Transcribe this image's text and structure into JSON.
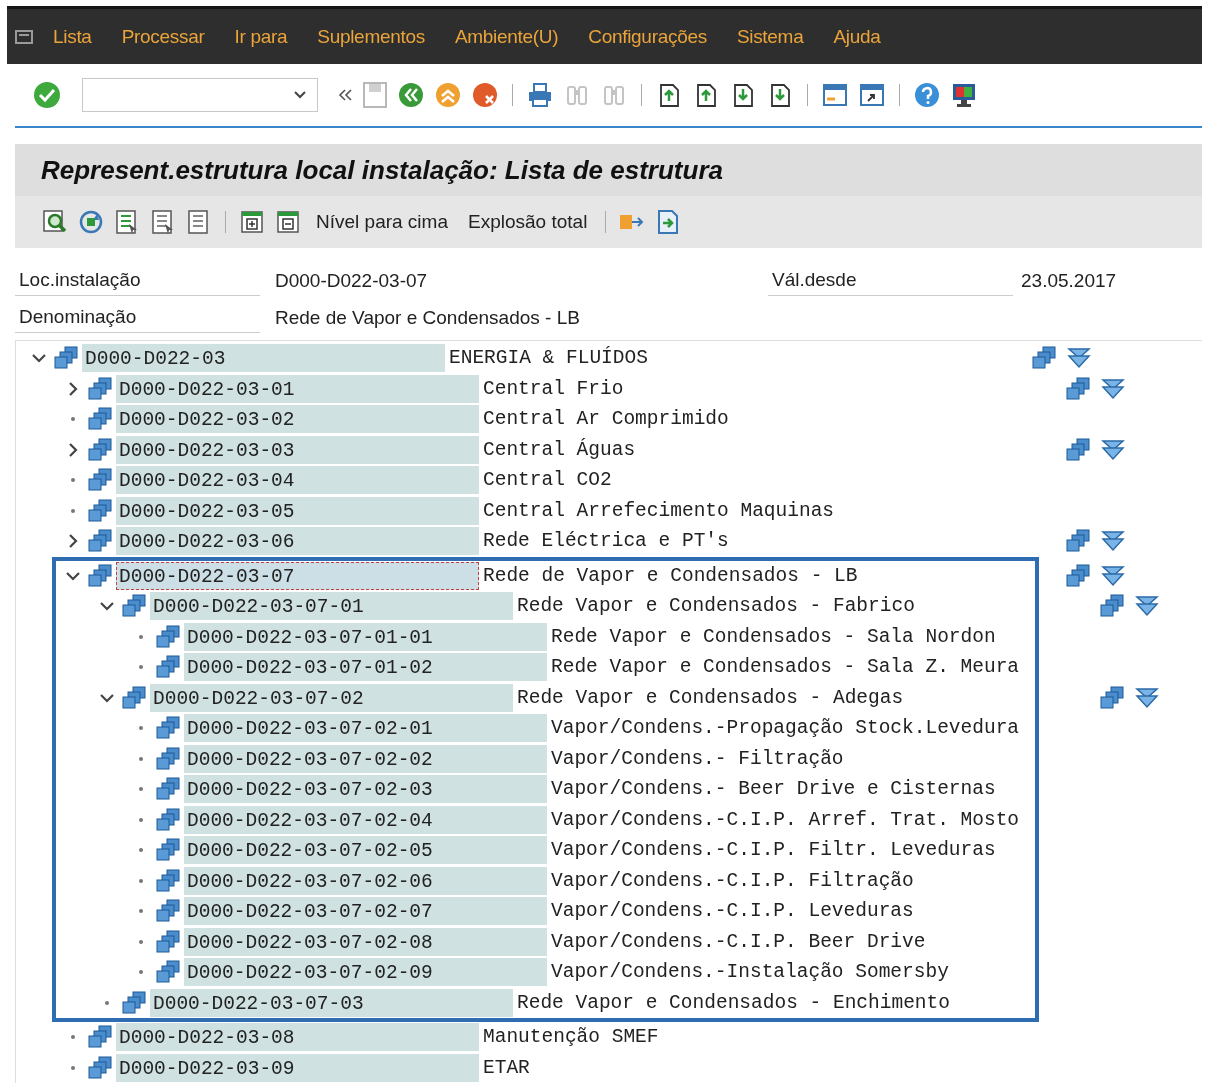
{
  "menu": [
    {
      "label": "Lista"
    },
    {
      "label": "Processar"
    },
    {
      "label": "Ir para"
    },
    {
      "label": "Suplementos"
    },
    {
      "label": "Ambiente(U)"
    },
    {
      "label": "Configurações"
    },
    {
      "label": "Sistema"
    },
    {
      "label": "Ajuda"
    }
  ],
  "title": "Represent.estrutura local instalação: Lista de estrutura",
  "app_toolbar": {
    "buttons": [
      {
        "label": "Nível para cima"
      },
      {
        "label": "Explosão total"
      }
    ]
  },
  "header": {
    "rows": [
      [
        {
          "label": "Loc.instalação",
          "value": "D000-D022-03-07"
        },
        {
          "label": "Vál.desde",
          "value": "23.05.2017"
        }
      ],
      [
        {
          "label": "Denominação",
          "value": "Rede de Vapor e Condensados - LB"
        }
      ]
    ]
  },
  "tree": [
    {
      "code": "D000-D022-03",
      "text": "ENERGIA & FLUÍDOS",
      "kind": "branch",
      "expanded": true,
      "selected": false,
      "highlighted": false,
      "actions": true,
      "children": [
        {
          "code": "D000-D022-03-01",
          "text": "Central Frio",
          "kind": "branch",
          "expanded": false,
          "selected": false,
          "highlighted": false,
          "actions": true
        },
        {
          "code": "D000-D022-03-02",
          "text": "Central Ar Comprimido",
          "kind": "leaf",
          "selected": false,
          "highlighted": false,
          "actions": false
        },
        {
          "code": "D000-D022-03-03",
          "text": "Central Águas",
          "kind": "branch",
          "expanded": false,
          "selected": false,
          "highlighted": false,
          "actions": true
        },
        {
          "code": "D000-D022-03-04",
          "text": "Central CO2",
          "kind": "leaf",
          "selected": false,
          "highlighted": false,
          "actions": false
        },
        {
          "code": "D000-D022-03-05",
          "text": "Central Arrefecimento Maquinas",
          "kind": "leaf",
          "selected": false,
          "highlighted": false,
          "actions": false
        },
        {
          "code": "D000-D022-03-06",
          "text": "Rede Eléctrica e PT's",
          "kind": "branch",
          "expanded": false,
          "selected": false,
          "highlighted": false,
          "actions": true
        },
        {
          "code": "D000-D022-03-07",
          "text": "Rede de Vapor e Condensados - LB",
          "kind": "branch",
          "expanded": true,
          "selected": true,
          "highlighted": true,
          "actions": true,
          "children": [
            {
              "code": "D000-D022-03-07-01",
              "text": "Rede Vapor e Condensados - Fabrico",
              "kind": "branch",
              "expanded": true,
              "selected": false,
              "highlighted": false,
              "actions": true,
              "children": [
                {
                  "code": "D000-D022-03-07-01-01",
                  "text": "Rede Vapor e Condensados - Sala Nordon",
                  "kind": "leaf",
                  "selected": false,
                  "highlighted": false,
                  "actions": false
                },
                {
                  "code": "D000-D022-03-07-01-02",
                  "text": "Rede Vapor e Condensados - Sala Z. Meura",
                  "kind": "leaf",
                  "selected": false,
                  "highlighted": false,
                  "actions": false
                }
              ]
            },
            {
              "code": "D000-D022-03-07-02",
              "text": "Rede Vapor e Condensados - Adegas",
              "kind": "branch",
              "expanded": true,
              "selected": false,
              "highlighted": false,
              "actions": true,
              "children": [
                {
                  "code": "D000-D022-03-07-02-01",
                  "text": "Vapor/Condens.-Propagação Stock.Levedura",
                  "kind": "leaf",
                  "selected": false,
                  "highlighted": false,
                  "actions": false
                },
                {
                  "code": "D000-D022-03-07-02-02",
                  "text": "Vapor/Condens.- Filtração",
                  "kind": "leaf",
                  "selected": false,
                  "highlighted": false,
                  "actions": false
                },
                {
                  "code": "D000-D022-03-07-02-03",
                  "text": "Vapor/Condens.- Beer Drive e Cisternas",
                  "kind": "leaf",
                  "selected": false,
                  "highlighted": false,
                  "actions": false
                },
                {
                  "code": "D000-D022-03-07-02-04",
                  "text": "Vapor/Condens.-C.I.P. Arref. Trat. Mosto",
                  "kind": "leaf",
                  "selected": false,
                  "highlighted": false,
                  "actions": false
                },
                {
                  "code": "D000-D022-03-07-02-05",
                  "text": "Vapor/Condens.-C.I.P. Filtr. Leveduras",
                  "kind": "leaf",
                  "selected": false,
                  "highlighted": false,
                  "actions": false
                },
                {
                  "code": "D000-D022-03-07-02-06",
                  "text": "Vapor/Condens.-C.I.P. Filtração",
                  "kind": "leaf",
                  "selected": false,
                  "highlighted": false,
                  "actions": false
                },
                {
                  "code": "D000-D022-03-07-02-07",
                  "text": "Vapor/Condens.-C.I.P. Leveduras",
                  "kind": "leaf",
                  "selected": false,
                  "highlighted": false,
                  "actions": false
                },
                {
                  "code": "D000-D022-03-07-02-08",
                  "text": "Vapor/Condens.-C.I.P. Beer Drive",
                  "kind": "leaf",
                  "selected": false,
                  "highlighted": false,
                  "actions": false
                },
                {
                  "code": "D000-D022-03-07-02-09",
                  "text": "Vapor/Condens.-Instalação Somersby",
                  "kind": "leaf",
                  "selected": false,
                  "highlighted": false,
                  "actions": false
                }
              ]
            },
            {
              "code": "D000-D022-03-07-03",
              "text": "Rede Vapor e Condensados - Enchimento",
              "kind": "leaf",
              "selected": false,
              "highlighted": false,
              "actions": false
            }
          ]
        },
        {
          "code": "D000-D022-03-08",
          "text": "Manutenção SMEF",
          "kind": "leaf",
          "selected": false,
          "highlighted": false,
          "actions": false
        },
        {
          "code": "D000-D022-03-09",
          "text": "ETAR",
          "kind": "leaf",
          "selected": false,
          "highlighted": false,
          "actions": false
        }
      ]
    }
  ]
}
